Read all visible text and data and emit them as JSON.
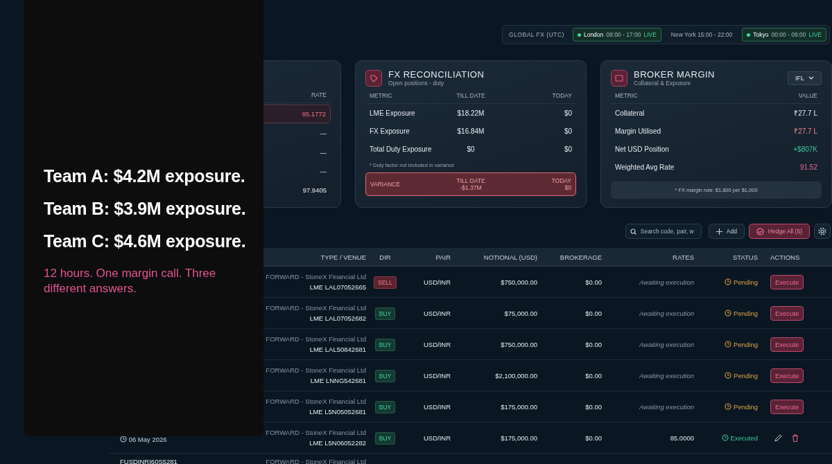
{
  "sessions": {
    "label": "GLOBAL FX (UTC)",
    "items": [
      {
        "name": "London",
        "hours": "08:00 - 17:00",
        "live": true,
        "badge": "LIVE"
      },
      {
        "name": "New York",
        "hours": "15:00 - 22:00",
        "live": false
      },
      {
        "name": "Tokyo",
        "hours": "00:00 - 09:00",
        "live": true,
        "badge": "LIVE"
      }
    ]
  },
  "live_rates": {
    "rate_header": "RATE",
    "rows": [
      {
        "rate": "95.1772",
        "highlighted": true
      },
      {
        "rate": "—",
        "highlighted": false
      },
      {
        "rate": "—",
        "highlighted": false
      },
      {
        "rate": "—",
        "highlighted": false
      },
      {
        "rate": "97.9405",
        "highlighted": false
      }
    ]
  },
  "reconciliation": {
    "title": "FX RECONCILIATION",
    "subtitle": "Open positions - duty",
    "columns": [
      "METRIC",
      "TILL DATE",
      "TODAY"
    ],
    "rows": [
      {
        "metric": "LME Exposure",
        "till_date": "$18.22M",
        "today": "$0"
      },
      {
        "metric": "FX Exposure",
        "till_date": "$16.84M",
        "today": "$0"
      },
      {
        "metric": "Total Duty Exposure",
        "till_date": "$0",
        "today": "$0"
      }
    ],
    "note": "* Duty factor not included in variance",
    "variance": {
      "label": "VARIANCE",
      "till_date_label": "TILL DATE",
      "till_date": "-$1.37M",
      "today_label": "TODAY",
      "today": "$0"
    }
  },
  "broker_margin": {
    "title": "BROKER MARGIN",
    "subtitle": "Collateral & Exposure",
    "broker": "IFL",
    "columns": [
      "METRIC",
      "VALUE"
    ],
    "rows": [
      {
        "metric": "Collateral",
        "value": "₹27.7 L",
        "kind": "neutral"
      },
      {
        "metric": "Margin Utilised",
        "value": "₹27.7 L",
        "kind": "negative"
      },
      {
        "metric": "Net USD Position",
        "value": "+$807K",
        "kind": "positive"
      },
      {
        "metric": "Weighted Avg Rate",
        "value": "91.52",
        "kind": "accent"
      }
    ],
    "note": "* FX margin rule: $1,800 per $1,000"
  },
  "contracts": {
    "search_placeholder": "Search code, pair, w",
    "add_label": "Add",
    "hedge_label": "Hedge All (5)",
    "columns": [
      "TYPE / VENUE",
      "DIR",
      "PAIR",
      "NOTIONAL (USD)",
      "BROKERAGE",
      "RATES",
      "STATUS",
      "ACTIONS"
    ],
    "rows": [
      {
        "kind": "full",
        "type": "FORWARD - StoneX Financial Ltd",
        "venue": "LME LAL07052665",
        "dir": {
          "text": "SELL",
          "kind": "sell"
        },
        "pair": "USD/INR",
        "notional": "$750,000.00",
        "brokerage": "$0.00",
        "rate": "Awaiting execution",
        "status": {
          "text": "Pending",
          "kind": "pending"
        },
        "action": "Execute"
      },
      {
        "kind": "full",
        "type": "FORWARD - StoneX Financial Ltd",
        "venue": "LME LAL07052682",
        "dir": {
          "text": "BUY",
          "kind": "buy"
        },
        "pair": "USD/INR",
        "notional": "$75,000.00",
        "brokerage": "$0.00",
        "rate": "Awaiting execution",
        "status": {
          "text": "Pending",
          "kind": "pending"
        },
        "action": "Execute"
      },
      {
        "kind": "full",
        "type": "FORWARD - StoneX Financial Ltd",
        "venue": "LME LAL50842681",
        "dir": {
          "text": "BUY",
          "kind": "buy"
        },
        "pair": "USD/INR",
        "notional": "$750,000.00",
        "brokerage": "$0.00",
        "rate": "Awaiting execution",
        "status": {
          "text": "Pending",
          "kind": "pending"
        },
        "action": "Execute"
      },
      {
        "kind": "full",
        "type": "FORWARD - StoneX Financial Ltd",
        "venue": "LME LNNG542681",
        "dir": {
          "text": "BUY",
          "kind": "buy"
        },
        "pair": "USD/INR",
        "notional": "$2,100,000.00",
        "brokerage": "$0.00",
        "rate": "Awaiting execution",
        "status": {
          "text": "Pending",
          "kind": "pending"
        },
        "action": "Execute"
      },
      {
        "kind": "full",
        "type": "FORWARD - StoneX Financial Ltd",
        "venue": "LME L5N05052681",
        "dir": {
          "text": "BUY",
          "kind": "buy"
        },
        "pair": "USD/INR",
        "notional": "$175,000.00",
        "brokerage": "$0.00",
        "rate": "Awaiting execution",
        "status": {
          "text": "Pending",
          "kind": "pending"
        },
        "action": "Execute"
      },
      {
        "kind": "full",
        "date": "06 May 2026",
        "type": "FORWARD - StoneX Financial Ltd",
        "venue": "LME L5N06052282",
        "dir": {
          "text": "BUY",
          "kind": "buy"
        },
        "pair": "USD/INR",
        "notional": "$175,000.00",
        "brokerage": "$0.00",
        "rate": "85.0000",
        "status": {
          "text": "Executed",
          "kind": "executed"
        }
      },
      {
        "kind": "partial",
        "code": "FUSDINRI60S5281",
        "type": "FORWARD - StoneX Financial Ltd"
      }
    ]
  },
  "promo": {
    "headlines": [
      "Team A: $4.2M exposure.",
      "Team B: $3.9M exposure.",
      "Team C: $4.6M exposure."
    ],
    "tagline": "12 hours. One margin call. Three different answers."
  }
}
